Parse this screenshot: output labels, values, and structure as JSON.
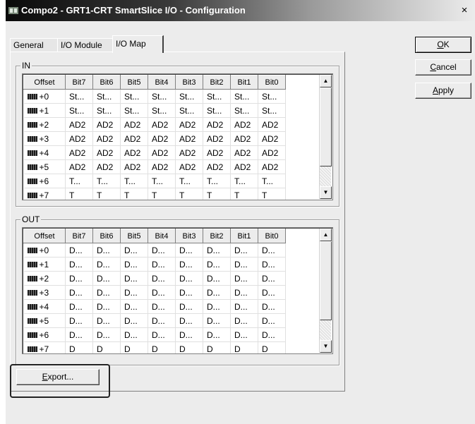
{
  "window": {
    "title": "Compo2 - GRT1-CRT SmartSlice I/O - Configuration",
    "close_glyph": "×"
  },
  "tabs": [
    {
      "label": "General",
      "active": false
    },
    {
      "label": "I/O Module",
      "active": false
    },
    {
      "label": "I/O Map",
      "active": true
    }
  ],
  "buttons": {
    "ok": {
      "label": "OK",
      "mnemonic": "O",
      "rest": "K"
    },
    "cancel": {
      "label": "Cancel",
      "mnemonic": "C",
      "rest": "ancel"
    },
    "apply": {
      "label": "Apply",
      "mnemonic": "A",
      "rest": "pply"
    },
    "export": {
      "label": "Export...",
      "mnemonic": "E",
      "rest": "xport..."
    }
  },
  "in_group": {
    "legend": "IN",
    "columns": [
      "Offset",
      "Bit7",
      "Bit6",
      "Bit5",
      "Bit4",
      "Bit3",
      "Bit2",
      "Bit1",
      "Bit0"
    ],
    "rows": [
      {
        "offset": "+0",
        "bits": [
          "St...",
          "St...",
          "St...",
          "St...",
          "St...",
          "St...",
          "St...",
          "St..."
        ]
      },
      {
        "offset": "+1",
        "bits": [
          "St...",
          "St...",
          "St...",
          "St...",
          "St...",
          "St...",
          "St...",
          "St..."
        ]
      },
      {
        "offset": "+2",
        "bits": [
          "AD2",
          "AD2",
          "AD2",
          "AD2",
          "AD2",
          "AD2",
          "AD2",
          "AD2"
        ]
      },
      {
        "offset": "+3",
        "bits": [
          "AD2",
          "AD2",
          "AD2",
          "AD2",
          "AD2",
          "AD2",
          "AD2",
          "AD2"
        ]
      },
      {
        "offset": "+4",
        "bits": [
          "AD2",
          "AD2",
          "AD2",
          "AD2",
          "AD2",
          "AD2",
          "AD2",
          "AD2"
        ]
      },
      {
        "offset": "+5",
        "bits": [
          "AD2",
          "AD2",
          "AD2",
          "AD2",
          "AD2",
          "AD2",
          "AD2",
          "AD2"
        ]
      },
      {
        "offset": "+6",
        "bits": [
          "T...",
          "T...",
          "T...",
          "T...",
          "T...",
          "T...",
          "T...",
          "T..."
        ]
      },
      {
        "offset": "+7",
        "bits": [
          "T",
          "T",
          "T",
          "T",
          "T",
          "T",
          "T",
          "T"
        ]
      }
    ]
  },
  "out_group": {
    "legend": "OUT",
    "columns": [
      "Offset",
      "Bit7",
      "Bit6",
      "Bit5",
      "Bit4",
      "Bit3",
      "Bit2",
      "Bit1",
      "Bit0"
    ],
    "rows": [
      {
        "offset": "+0",
        "bits": [
          "D...",
          "D...",
          "D...",
          "D...",
          "D...",
          "D...",
          "D...",
          "D..."
        ]
      },
      {
        "offset": "+1",
        "bits": [
          "D...",
          "D...",
          "D...",
          "D...",
          "D...",
          "D...",
          "D...",
          "D..."
        ]
      },
      {
        "offset": "+2",
        "bits": [
          "D...",
          "D...",
          "D...",
          "D...",
          "D...",
          "D...",
          "D...",
          "D..."
        ]
      },
      {
        "offset": "+3",
        "bits": [
          "D...",
          "D...",
          "D...",
          "D...",
          "D...",
          "D...",
          "D...",
          "D..."
        ]
      },
      {
        "offset": "+4",
        "bits": [
          "D...",
          "D...",
          "D...",
          "D...",
          "D...",
          "D...",
          "D...",
          "D..."
        ]
      },
      {
        "offset": "+5",
        "bits": [
          "D...",
          "D...",
          "D...",
          "D...",
          "D...",
          "D...",
          "D...",
          "D..."
        ]
      },
      {
        "offset": "+6",
        "bits": [
          "D...",
          "D...",
          "D...",
          "D...",
          "D...",
          "D...",
          "D...",
          "D..."
        ]
      },
      {
        "offset": "+7",
        "bits": [
          "D",
          "D",
          "D",
          "D",
          "D",
          "D",
          "D",
          "D"
        ]
      }
    ]
  },
  "icons": {
    "app": "app-icon",
    "row": "io-word-icon",
    "scroll_up": "scroll-up-arrow-icon",
    "scroll_down": "scroll-down-arrow-icon"
  }
}
